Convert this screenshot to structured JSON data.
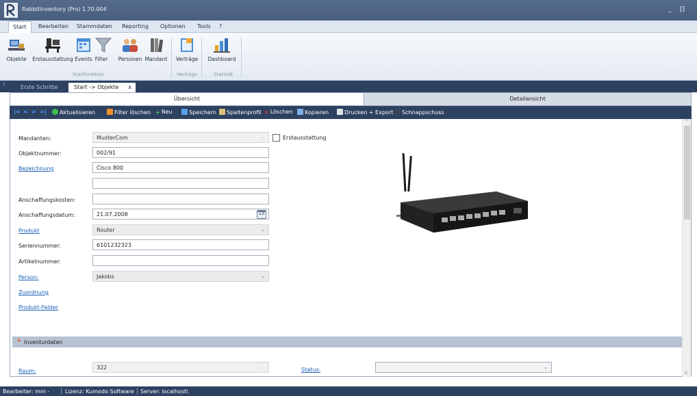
{
  "window": {
    "title": "RabbitInventory (Pro) 1.70.004",
    "minimize": "_",
    "maximize": "[]"
  },
  "menu": [
    "Start",
    "Bearbeiten",
    "Stammdaten",
    "Reporting",
    "Optionen",
    "Tools",
    "?"
  ],
  "ribbon": {
    "buttons": [
      "Objekte",
      "Erstausstattung",
      "Events",
      "Filter",
      "Personen",
      "Mandant",
      "Verträge",
      "Dashboard"
    ],
    "groups": [
      "Startfunktion",
      "Verträge",
      "Statistik"
    ]
  },
  "tabs": [
    "Erste Schritte",
    "Start -> Objekte",
    "x"
  ],
  "subtabs": [
    "Übersicht",
    "Detailansicht"
  ],
  "toolbar": {
    "nav": [
      "|<",
      "<",
      ">",
      ">|"
    ],
    "refresh": "Aktualisieren",
    "clear_filter": "Filter löschen",
    "new": "Neu",
    "save": "Speichern",
    "column_profile": "Spaltenprofil",
    "delete": "Löschen",
    "copy": "Kopieren",
    "print_export": "Drucken + Export",
    "snapshot": "Schnappschuss"
  },
  "form": {
    "mandanten": {
      "label": "Mandanten:",
      "value": "MusterCom"
    },
    "erstausstattung_label": "Erstausstattung",
    "objektnummer": {
      "label": "Objektnummer:",
      "value": "002/91"
    },
    "bezeichnung": {
      "label": "Bezeichnung",
      "value": "Cisco 800",
      "value2": ""
    },
    "anschaffungskosten": {
      "label": "Anschaffungskosten:",
      "value": ""
    },
    "anschaffungsdatum": {
      "label": "Anschaffungsdatum:",
      "value": "21.07.2008",
      "cal_day": "15"
    },
    "produkt": {
      "label": "Produkt",
      "value": "Router"
    },
    "seriennummer": {
      "label": "Seriennummer:",
      "value": "6101232323"
    },
    "artikelnummer": {
      "label": "Artikelnummer:",
      "value": ""
    },
    "person": {
      "label": "Person:",
      "value": "Jakobs"
    },
    "zuordnung": "Zuordnung",
    "produkt_felder": "Produkt-Felder"
  },
  "inventur": {
    "title": "Inventurdaten",
    "raum": {
      "label": "Raum:",
      "value": "322"
    },
    "status": {
      "label": "Status:",
      "value": ""
    }
  },
  "statusbar": {
    "bearbeiter": "Bearbeiter: mm -",
    "lizenz": "Lizenz: Kumodo Software",
    "server": "Server: localhost\\"
  }
}
